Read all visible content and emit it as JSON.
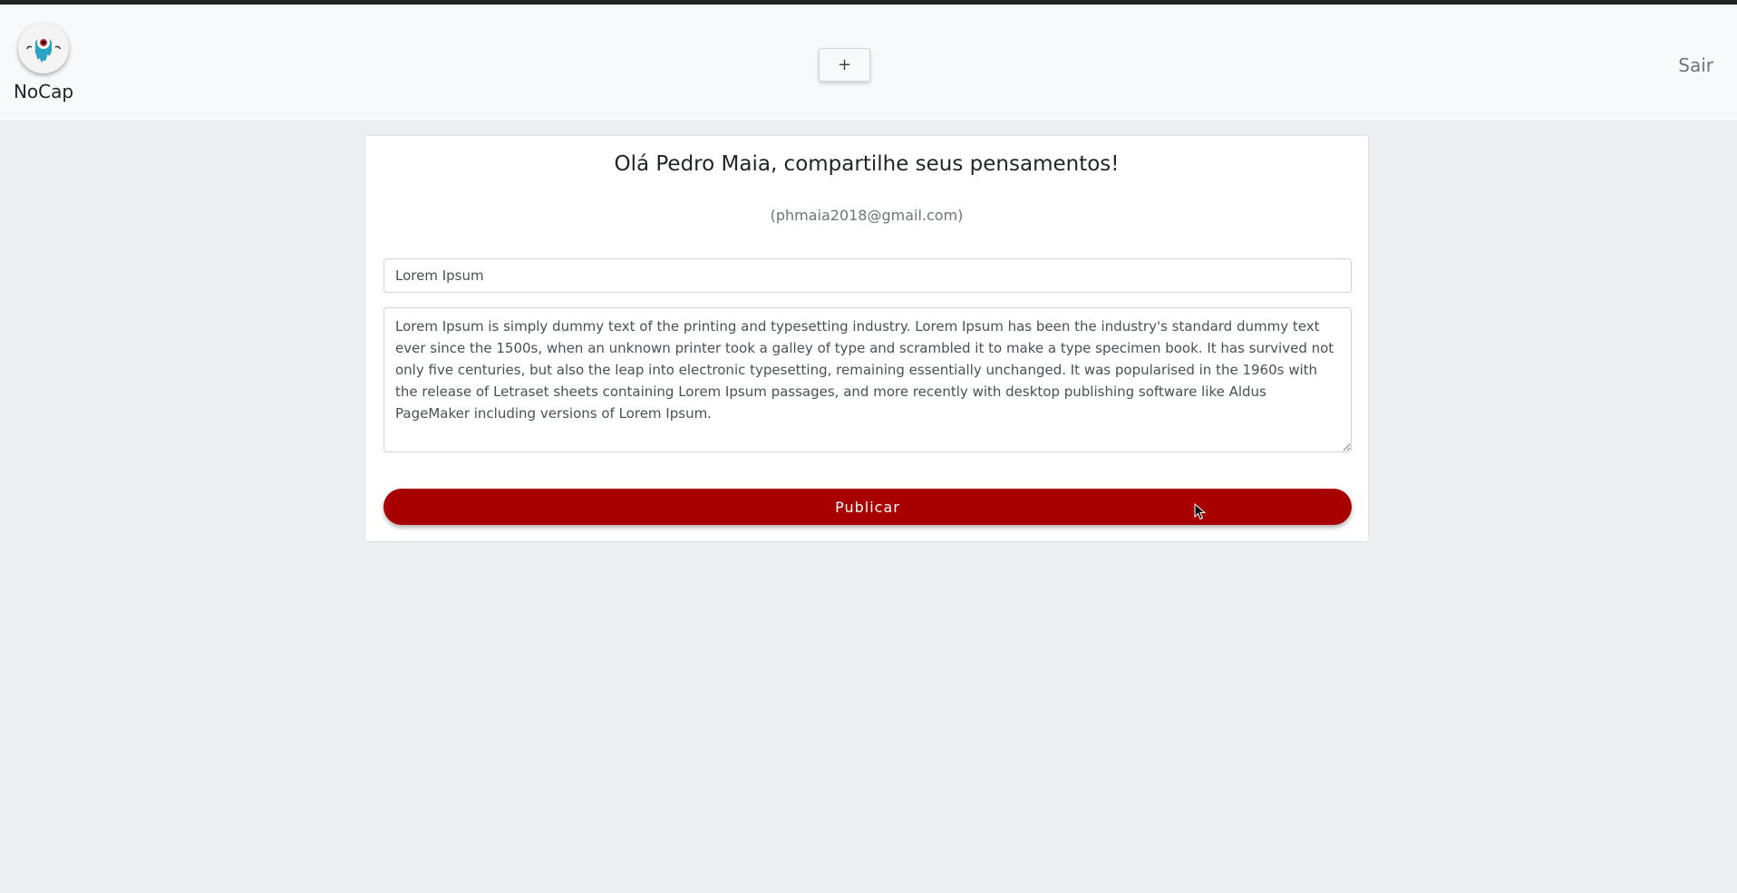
{
  "navbar": {
    "brand_name": "NoCap",
    "add_label": "+",
    "logout_label": "Sair"
  },
  "post_form": {
    "greeting": "Olá Pedro Maia, compartilhe seus pensamentos!",
    "email": "(phmaia2018@gmail.com)",
    "title_value": "Lorem Ipsum",
    "content_value": "Lorem Ipsum is simply dummy text of the printing and typesetting industry. Lorem Ipsum has been the industry's standard dummy text ever since the 1500s, when an unknown printer took a galley of type and scrambled it to make a type specimen book. It has survived not only five centuries, but also the leap into electronic typesetting, remaining essentially unchanged. It was popularised in the 1960s with the release of Letraset sheets containing Lorem Ipsum passages, and more recently with desktop publishing software like Aldus PageMaker including versions of Lorem Ipsum.",
    "publish_label": "Publicar"
  },
  "icons": {
    "logo": "nocap-eyeball-mascot-logo",
    "cursor": "mouse-pointer-icon"
  },
  "colors": {
    "accent": "#a80000",
    "page_background": "#eceff2",
    "navbar_background": "#f8f9fa"
  }
}
